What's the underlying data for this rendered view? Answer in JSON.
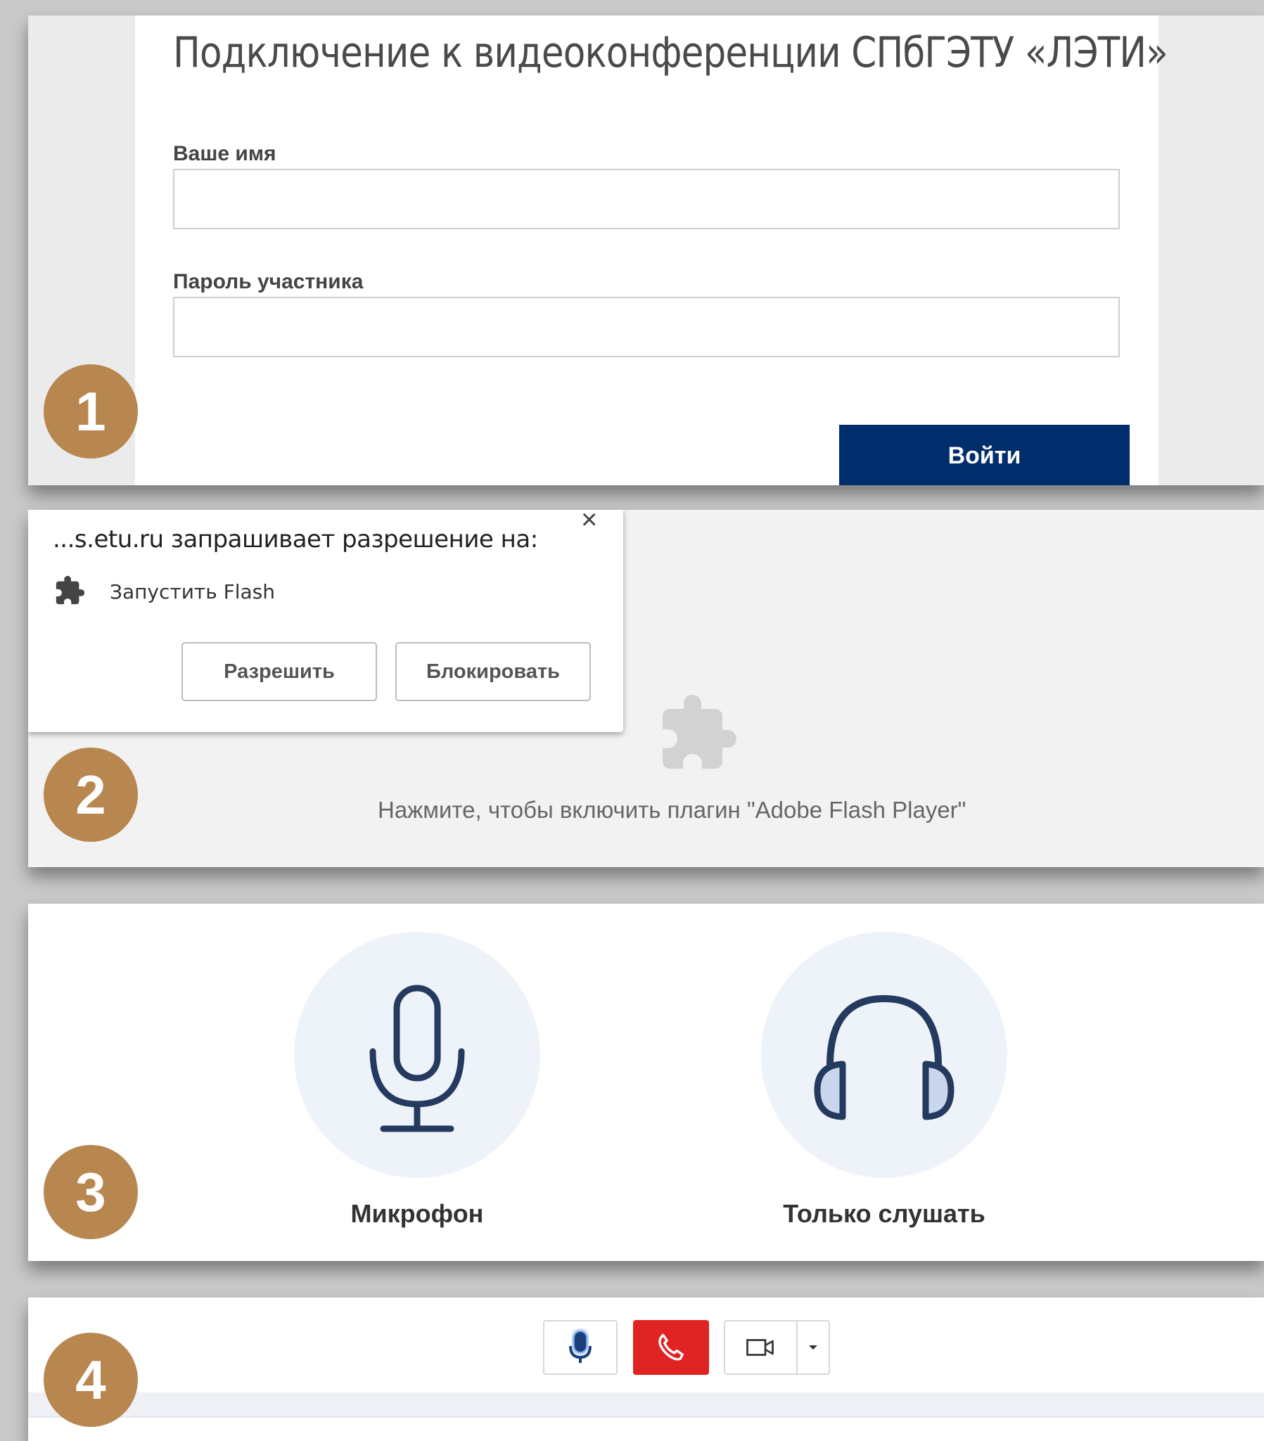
{
  "badges": [
    "1",
    "2",
    "3",
    "4"
  ],
  "login": {
    "title": "Подключение к видеоконференции СПбГЭТУ «ЛЭТИ»",
    "name_label": "Ваше имя",
    "name_value": "",
    "password_label": "Пароль участника",
    "password_value": "",
    "submit_label": "Войти"
  },
  "flash": {
    "request_text": "...s.etu.ru запрашивает разрешение на:",
    "close_symbol": "×",
    "permission_text": "Запустить Flash",
    "allow_label": "Разрешить",
    "block_label": "Блокировать",
    "plugin_hint": "Нажмите, чтобы включить плагин \"Adobe Flash Player\""
  },
  "audio": {
    "microphone_label": "Микрофон",
    "listen_only_label": "Только слушать"
  },
  "controls": {
    "accent_colors": {
      "hangup": "#e02424",
      "mic": "#2a6fd6"
    },
    "icons": [
      "microphone-icon",
      "phone-hangup-icon",
      "video-camera-icon",
      "caret-down-icon"
    ]
  }
}
